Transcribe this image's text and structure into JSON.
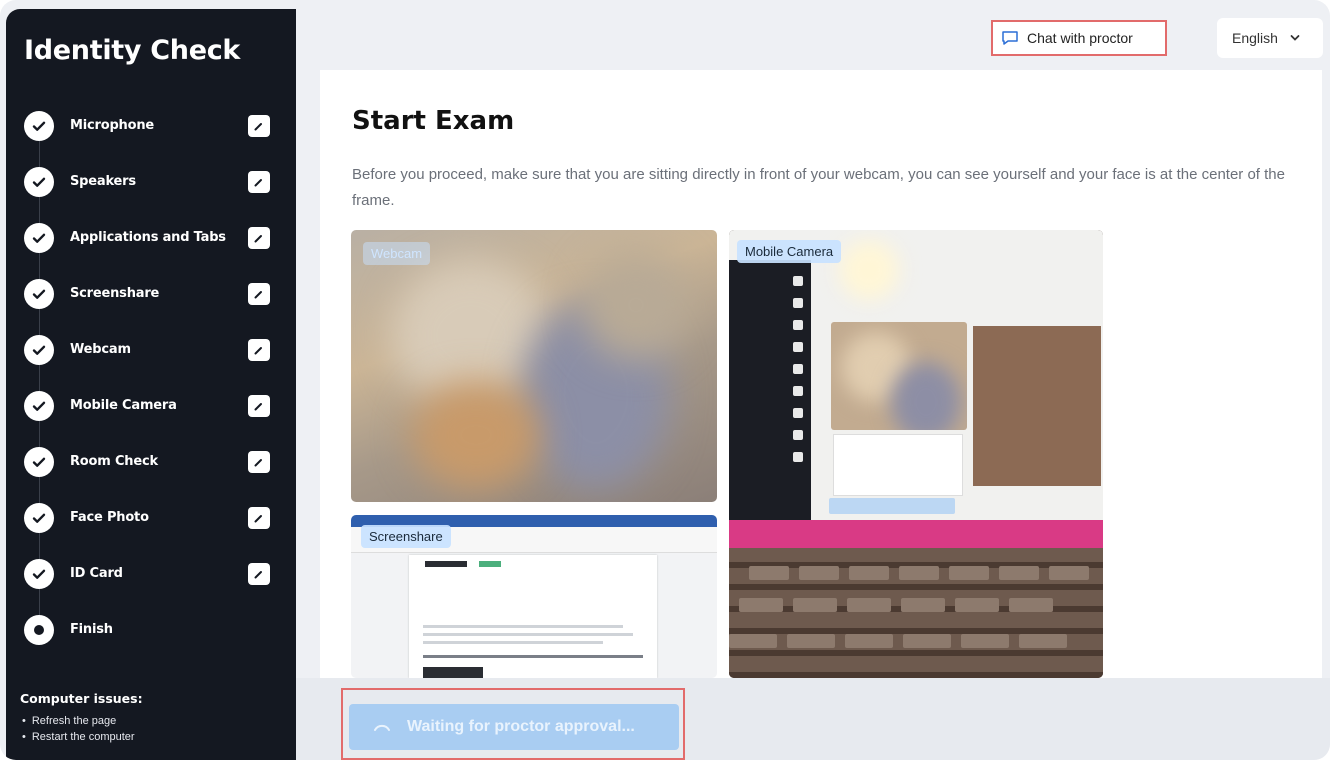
{
  "sidebar": {
    "title": "Identity Check",
    "steps": [
      {
        "label": "Microphone",
        "state": "done",
        "icon": "check-icon"
      },
      {
        "label": "Speakers",
        "state": "done",
        "icon": "check-icon"
      },
      {
        "label": "Applications and Tabs",
        "state": "done",
        "icon": "check-icon"
      },
      {
        "label": "Screenshare",
        "state": "done",
        "icon": "check-icon"
      },
      {
        "label": "Webcam",
        "state": "done",
        "icon": "check-icon"
      },
      {
        "label": "Mobile Camera",
        "state": "done",
        "icon": "check-icon"
      },
      {
        "label": "Room Check",
        "state": "done",
        "icon": "check-icon"
      },
      {
        "label": "Face Photo",
        "state": "done",
        "icon": "check-icon"
      },
      {
        "label": "ID Card",
        "state": "done",
        "icon": "check-icon"
      },
      {
        "label": "Finish",
        "state": "current",
        "icon": "dot-icon"
      }
    ],
    "issues": {
      "title": "Computer issues:",
      "items": [
        "Refresh the page",
        "Restart the computer"
      ]
    }
  },
  "header": {
    "chat_label": "Chat with proctor",
    "language": "English"
  },
  "main": {
    "title": "Start Exam",
    "description": "Before you proceed, make sure that you are sitting directly in front of your webcam, you can see yourself and your face is at the center of the frame.",
    "panels": {
      "webcam_label": "Webcam",
      "mobile_label": "Mobile Camera",
      "screenshare_label": "Screenshare"
    }
  },
  "footer": {
    "wait_label": "Waiting for proctor approval..."
  },
  "colors": {
    "sidebar_bg": "#141821",
    "highlight": "#e26b6b",
    "wait_button": "#a9cdf2"
  }
}
